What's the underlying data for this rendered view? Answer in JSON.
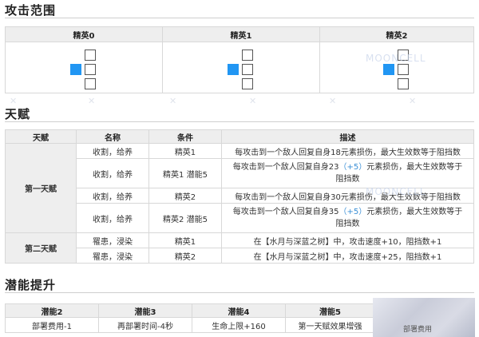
{
  "attack_range": {
    "title": "攻击范围",
    "columns": [
      "精英0",
      "精英1",
      "精英2"
    ]
  },
  "talent": {
    "title": "天赋",
    "headers": [
      "天赋",
      "名称",
      "条件",
      "描述"
    ],
    "groups": [
      {
        "label": "第一天赋",
        "rows": [
          {
            "name": "收割，给养",
            "condition": "精英1",
            "desc_pre": "每攻击到一个敌人回复自身18元素损伤，最大生效数等于阻挡数",
            "plus": "",
            "desc_post": ""
          },
          {
            "name": "收割，给养",
            "condition": "精英1 潜能5",
            "desc_pre": "每攻击到一个敌人回复自身23",
            "plus": "（+5）",
            "desc_post": "元素损伤，最大生效数等于阻挡数"
          },
          {
            "name": "收割，给养",
            "condition": "精英2",
            "desc_pre": "每攻击到一个敌人回复自身30元素损伤，最大生效数等于阻挡数",
            "plus": "",
            "desc_post": ""
          },
          {
            "name": "收割，给养",
            "condition": "精英2 潜能5",
            "desc_pre": "每攻击到一个敌人回复自身35",
            "plus": "（+5）",
            "desc_post": "元素损伤，最大生效数等于阻挡数"
          }
        ]
      },
      {
        "label": "第二天赋",
        "rows": [
          {
            "name": "罹患，浸染",
            "condition": "精英1",
            "desc_pre": "在【水月与深蓝之树】中，攻击速度+10，阻挡数+1",
            "plus": "",
            "desc_post": ""
          },
          {
            "name": "罹患，浸染",
            "condition": "精英2",
            "desc_pre": "在【水月与深蓝之树】中，攻击速度+25，阻挡数+1",
            "plus": "",
            "desc_post": ""
          }
        ]
      }
    ]
  },
  "potential": {
    "title": "潜能提升",
    "headers": [
      "潜能2",
      "潜能3",
      "潜能4",
      "潜能5"
    ],
    "values": [
      "部署费用-1",
      "再部署时间-4秒",
      "生命上限+160",
      "第一天赋效果增强"
    ]
  },
  "watermark": {
    "text": "MOONCELL"
  },
  "thumbnail": {
    "caption": "部署费用"
  },
  "colors": {
    "operator_tile": "#2196f3",
    "header_bg": "#eeeeee",
    "plus_value": "#3a8fd6"
  }
}
